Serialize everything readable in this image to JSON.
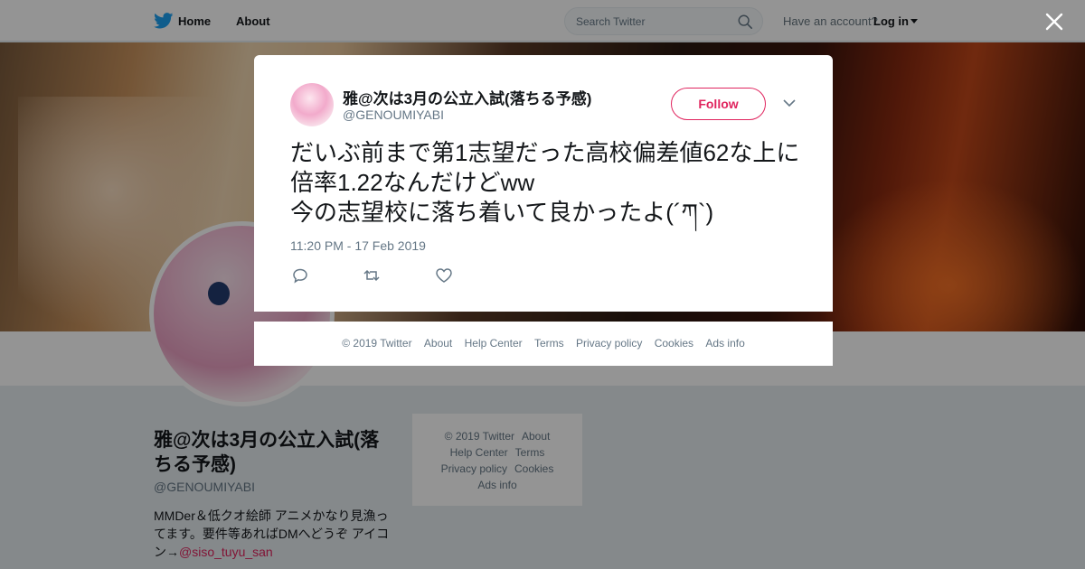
{
  "topbar": {
    "home_label": "Home",
    "about_label": "About",
    "search_placeholder": "Search Twitter",
    "have_account": "Have an account?",
    "login_label": "Log in"
  },
  "profile": {
    "name": "雅@次は3月の公立入試(落ちる予感)",
    "handle": "@GENOUMIYABI",
    "bio_text": "MMDer＆低クオ絵師 アニメかなり見漁ってます。要件等あればDMへどうぞ アイコン→",
    "bio_link": "@siso_tuyu_san"
  },
  "side_footer": {
    "items": [
      "© 2019 Twitter",
      "About",
      "Help Center",
      "Terms",
      "Privacy policy",
      "Cookies",
      "Ads info"
    ]
  },
  "tweet": {
    "name": "雅@次は3月の公立入試(落ちる予感)",
    "handle": "@GENOUMIYABI",
    "follow_label": "Follow",
    "text": "だいぶ前まで第1志望だった高校偏差値62な上に倍率1.22なんだけどww\n今の志望校に落ち着いて良かったよ(´ཀ`)",
    "timestamp": "11:20 PM - 17 Feb 2019"
  },
  "modal_footer": {
    "items": [
      "© 2019 Twitter",
      "About",
      "Help Center",
      "Terms",
      "Privacy policy",
      "Cookies",
      "Ads info"
    ]
  },
  "colors": {
    "accent": "#e0245e",
    "twitter_blue": "#1da1f2",
    "muted_text": "#657786"
  },
  "icons": [
    "twitter-bird-icon",
    "search-icon",
    "caret-down-icon",
    "close-icon",
    "chevron-down-icon",
    "reply-icon",
    "retweet-icon",
    "like-icon"
  ]
}
